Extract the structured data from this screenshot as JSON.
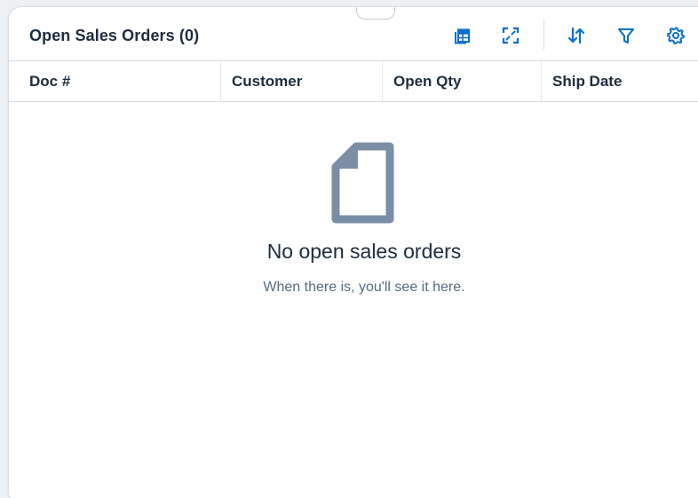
{
  "card": {
    "title": "Open Sales Orders (0)"
  },
  "toolbar": {
    "items": [
      {
        "name": "export-to-spreadsheet",
        "icon": "spreadsheet-export-icon"
      },
      {
        "name": "fullscreen",
        "icon": "fullscreen-icon"
      },
      {
        "name": "sort",
        "icon": "sort-icon"
      },
      {
        "name": "filter",
        "icon": "filter-icon"
      },
      {
        "name": "settings",
        "icon": "gear-icon"
      }
    ]
  },
  "table": {
    "columns": [
      "Doc #",
      "Customer",
      "Open Qty",
      "Ship Date"
    ]
  },
  "empty_state": {
    "icon": "document-icon",
    "title": "No open sales orders",
    "subtitle": "When there is, you'll see it here."
  },
  "colors": {
    "accent": "#0a6ed1",
    "title_text": "#1d2d3e",
    "subtitle_text": "#556b82",
    "empty_icon": "#7a8ea6"
  }
}
